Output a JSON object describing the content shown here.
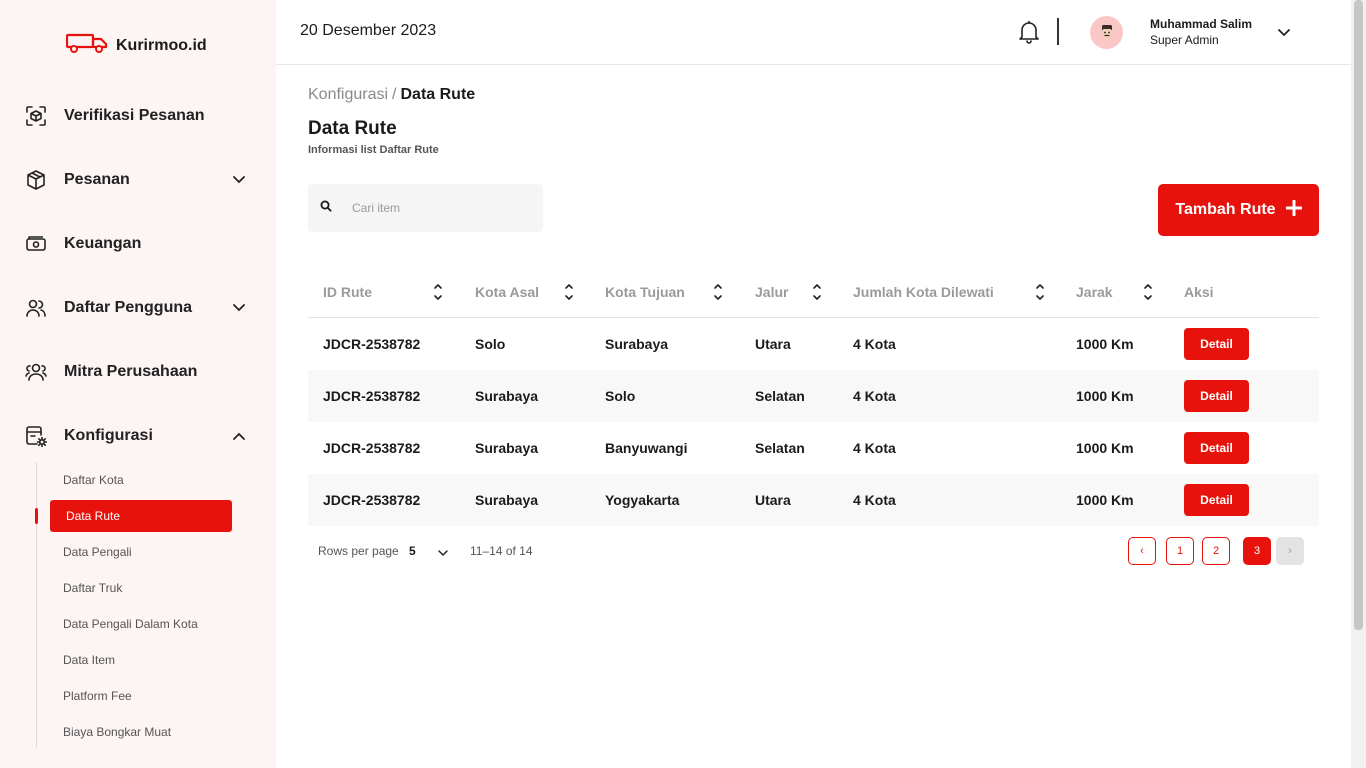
{
  "brand": {
    "name": "Kurirmoo.id",
    "accent": "#e8120c"
  },
  "header": {
    "date": "20 Desember 2023",
    "user": {
      "name": "Muhammad Salim",
      "role": "Super Admin"
    }
  },
  "sidebar": {
    "items": [
      {
        "label": "Verifikasi Pesanan",
        "icon": "scan-box-icon"
      },
      {
        "label": "Pesanan",
        "icon": "package-icon",
        "expandable": true
      },
      {
        "label": "Keuangan",
        "icon": "money-icon"
      },
      {
        "label": "Daftar Pengguna",
        "icon": "users-icon",
        "expandable": true
      },
      {
        "label": "Mitra Perusahaan",
        "icon": "partner-icon"
      },
      {
        "label": "Konfigurasi",
        "icon": "config-icon",
        "expandable": true,
        "expanded": true
      }
    ],
    "submenu": [
      {
        "label": "Daftar Kota"
      },
      {
        "label": "Data Rute",
        "active": true
      },
      {
        "label": "Data Pengali"
      },
      {
        "label": "Daftar Truk"
      },
      {
        "label": "Data Pengali Dalam Kota"
      },
      {
        "label": "Data Item"
      },
      {
        "label": "Platform Fee"
      },
      {
        "label": "Biaya Bongkar Muat"
      }
    ]
  },
  "breadcrumb": {
    "parent": "Konfigurasi",
    "separator": "/",
    "current": "Data Rute"
  },
  "page": {
    "title": "Data Rute",
    "subtitle": "Informasi list Daftar Rute"
  },
  "search": {
    "placeholder": "Cari item"
  },
  "add_button": {
    "label": "Tambah Rute"
  },
  "table": {
    "columns": [
      "ID Rute",
      "Kota Asal",
      "Kota Tujuan",
      "Jalur",
      "Jumlah Kota Dilewati",
      "Jarak",
      "Aksi"
    ],
    "rows": [
      {
        "id": "JDCR-2538782",
        "asal": "Solo",
        "tujuan": "Surabaya",
        "jalur": "Utara",
        "kota": "4 Kota",
        "jarak": "1000 Km",
        "aksi": "Detail"
      },
      {
        "id": "JDCR-2538782",
        "asal": "Surabaya",
        "tujuan": "Solo",
        "jalur": "Selatan",
        "kota": "4 Kota",
        "jarak": "1000 Km",
        "aksi": "Detail"
      },
      {
        "id": "JDCR-2538782",
        "asal": "Surabaya",
        "tujuan": "Banyuwangi",
        "jalur": "Selatan",
        "kota": "4 Kota",
        "jarak": "1000 Km",
        "aksi": "Detail"
      },
      {
        "id": "JDCR-2538782",
        "asal": "Surabaya",
        "tujuan": "Yogyakarta",
        "jalur": "Utara",
        "kota": "4 Kota",
        "jarak": "1000 Km",
        "aksi": "Detail"
      }
    ]
  },
  "pagination": {
    "rows_label": "Rows per page",
    "rows_value": "5",
    "range": "11–14 of 14",
    "prev": "‹",
    "next": "›",
    "pages": [
      "1",
      "2",
      "3"
    ],
    "current_page": "3"
  }
}
